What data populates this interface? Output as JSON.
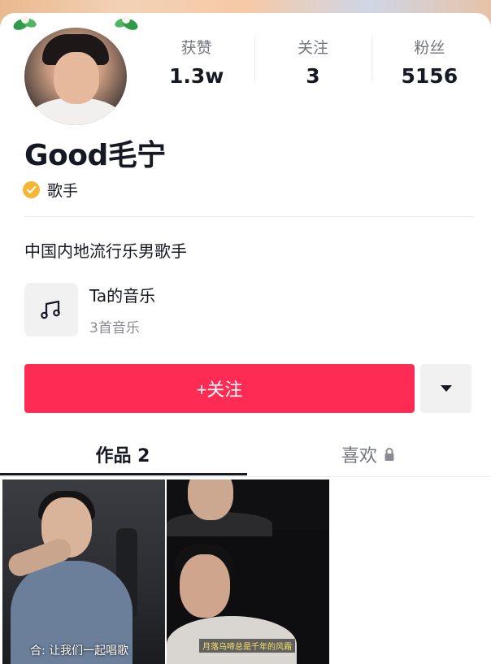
{
  "profile": {
    "username": "Good毛宁",
    "verified_label": "歌手",
    "bio": "中国内地流行乐男歌手"
  },
  "stats": [
    {
      "label": "获赞",
      "value": "1.3w"
    },
    {
      "label": "关注",
      "value": "3"
    },
    {
      "label": "粉丝",
      "value": "5156"
    }
  ],
  "music": {
    "title": "Ta的音乐",
    "subtitle": "3首音乐",
    "icon": "music-note-icon"
  },
  "actions": {
    "follow_label": "+关注",
    "more_icon": "caret-down-icon"
  },
  "tabs": [
    {
      "label": "作品 2",
      "active": true
    },
    {
      "label": "喜欢",
      "active": false,
      "icon": "lock-icon"
    }
  ],
  "videos": [
    {
      "caption": "合: 让我们一起唱歌"
    },
    {
      "caption": "月落乌啼总是千年的风霜"
    }
  ],
  "colors": {
    "accent": "#fe2c55",
    "verify": "#f5b733",
    "text": "#161823",
    "muted": "#73757d"
  }
}
